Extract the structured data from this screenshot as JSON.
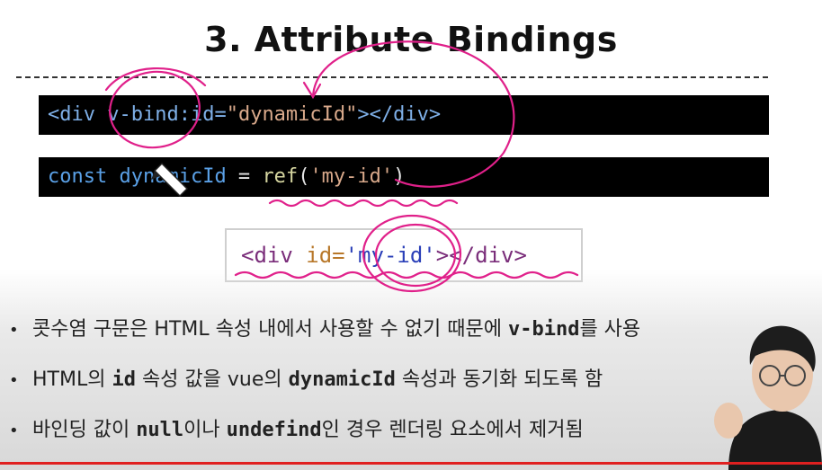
{
  "slide": {
    "title": "3. Attribute Bindings",
    "code_line_1": {
      "open_tag": "<div",
      "directive": " v-bind:",
      "attr": "id=",
      "value": "\"dynamicId\"",
      "close": "></div>"
    },
    "code_line_2": {
      "keyword": "const",
      "identifier": " dynamicId",
      "equals": " = ",
      "fn": "ref",
      "paren_open": "(",
      "arg": "'my-id'",
      "paren_close": ")"
    },
    "output": {
      "open": "<div ",
      "attr": "id=",
      "value": "'my-id'",
      "close": "></div>"
    },
    "bullets": [
      {
        "pre": "콧수염 구문은 HTML 속성 내에서 사용할 수 없기 때문에 ",
        "code": "v-bind",
        "post": "를 사용"
      },
      {
        "pre": "HTML의 ",
        "code": "id",
        "mid": " 속성 값을 vue의 ",
        "code2": "dynamicId",
        "post": " 속성과 동기화 되도록 함"
      },
      {
        "pre": "바인딩 값이 ",
        "code": "null",
        "mid": "이나 ",
        "code2": "undefind",
        "post": "인 경우 렌더링 요소에서 제거됨"
      }
    ],
    "bullet_marker": "•"
  },
  "colors": {
    "annotation": "#e0208a",
    "progress": "#e02020",
    "code_bg": "#000000"
  },
  "icons": [
    "pencil-cursor-icon"
  ]
}
